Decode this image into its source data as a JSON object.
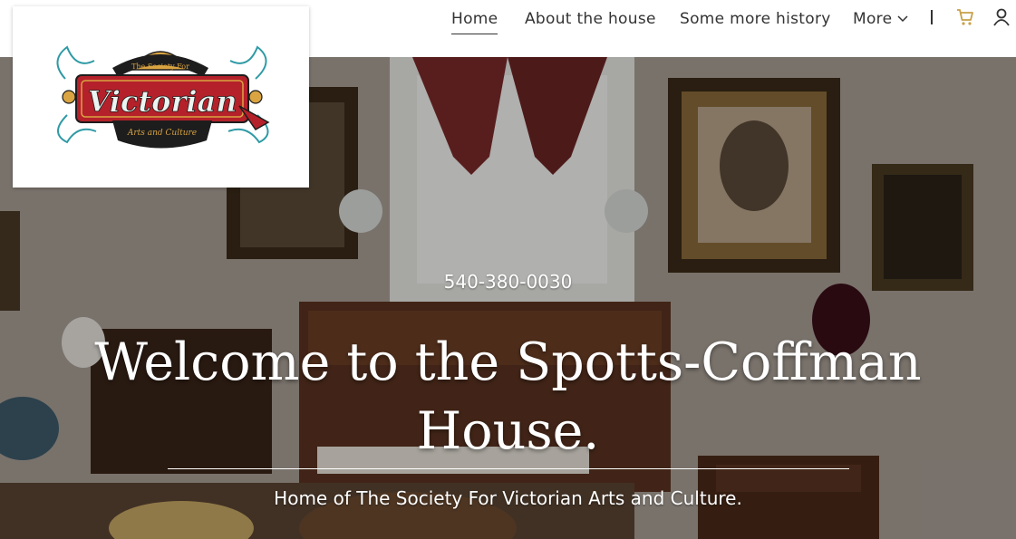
{
  "nav": {
    "items": [
      {
        "label": "Home",
        "active": true
      },
      {
        "label": "About the house",
        "active": false
      },
      {
        "label": "Some more history",
        "active": false
      },
      {
        "label": "More",
        "active": false
      }
    ],
    "icons": [
      "cart-icon",
      "user-icon"
    ]
  },
  "logo": {
    "top_text": "The Society For",
    "main_text": "Victorian",
    "bottom_text": "Arts and Culture",
    "colors": {
      "red": "#b5212a",
      "gold": "#d9a441",
      "teal": "#2e9aa5",
      "dark": "#1d1d1d"
    }
  },
  "hero": {
    "phone": "540-380-0030",
    "title": "Welcome to the Spotts-Coffman House.",
    "subtitle": "Home of The Society For Victorian Arts and Culture."
  },
  "colors": {
    "accent": "#c8a04a",
    "text": "#333333",
    "white": "#ffffff"
  }
}
